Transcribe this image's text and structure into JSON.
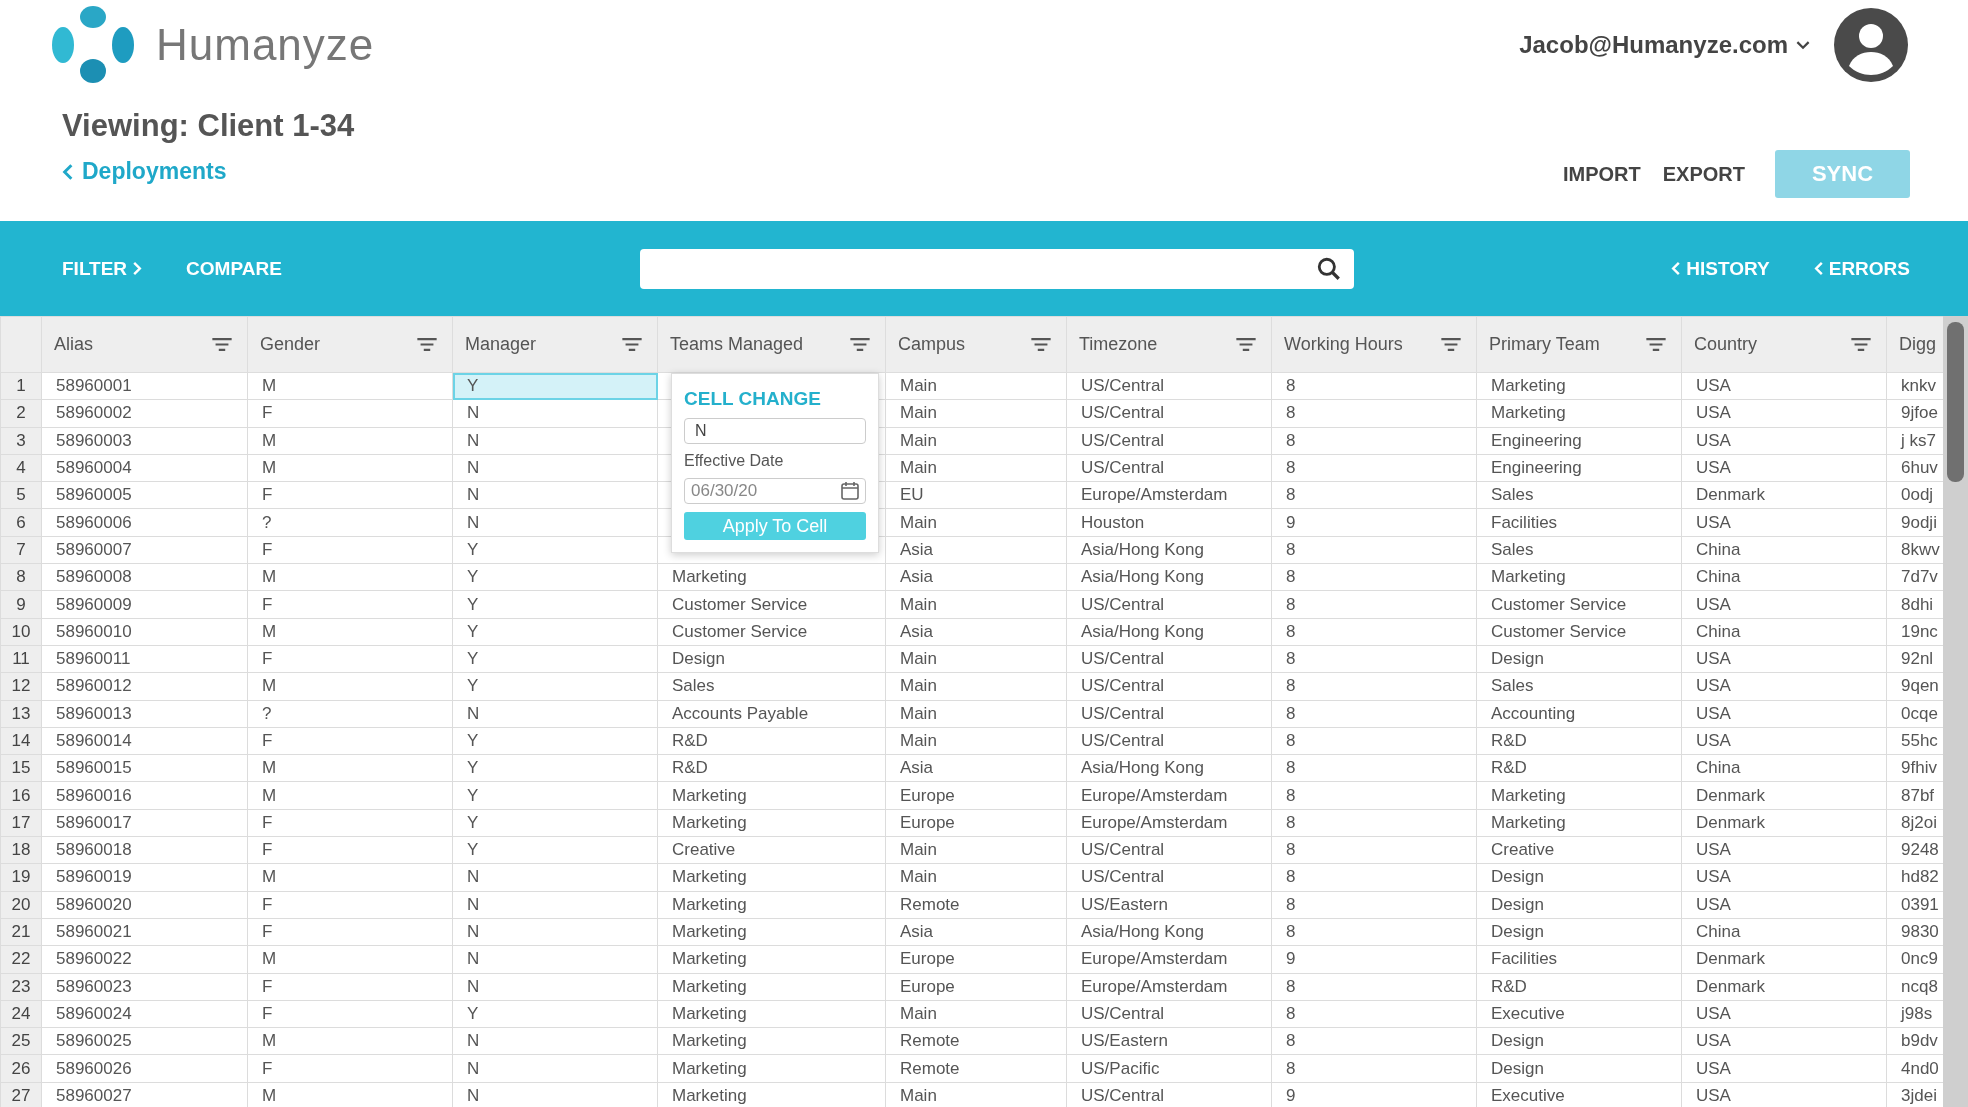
{
  "brand": {
    "name": "Humanyze"
  },
  "user": {
    "email": "Jacob@Humanyze.com"
  },
  "page": {
    "title": "Viewing: Client 1-34",
    "back_link": "Deployments"
  },
  "actions": [
    "IMPORT",
    "EXPORT"
  ],
  "sync_button": {
    "label": "SYNC",
    "disabled": true
  },
  "toolbar": {
    "left": [
      "FILTER",
      "COMPARE"
    ],
    "right": [
      "HISTORY",
      "ERRORS"
    ]
  },
  "columns": [
    {
      "label": "Alias",
      "filterable": true
    },
    {
      "label": "Gender",
      "filterable": true
    },
    {
      "label": "Manager",
      "filterable": true
    },
    {
      "label": "Teams Managed",
      "filterable": true
    },
    {
      "label": "Campus",
      "filterable": true
    },
    {
      "label": "Timezone",
      "filterable": true
    },
    {
      "label": "Working Hours",
      "filterable": true
    },
    {
      "label": "Primary Team",
      "filterable": true
    },
    {
      "label": "Country",
      "filterable": true
    },
    {
      "label": "Digg",
      "filterable": false
    }
  ],
  "rows": [
    {
      "num": "1",
      "cells": [
        "58960001",
        "M",
        "Y",
        null,
        "Main",
        "US/Central",
        "8",
        "Marketing",
        "USA",
        "knkv"
      ],
      "manager_selected": true
    },
    {
      "num": "2",
      "cells": [
        "58960002",
        "F",
        "N",
        null,
        "Main",
        "US/Central",
        "8",
        "Marketing",
        "USA",
        "9jfoe"
      ],
      "manager_selected": false
    },
    {
      "num": "3",
      "cells": [
        "58960003",
        "M",
        "N",
        null,
        "Main",
        "US/Central",
        "8",
        "Engineering",
        "USA",
        "j ks7"
      ],
      "manager_selected": false
    },
    {
      "num": "4",
      "cells": [
        "58960004",
        "M",
        "N",
        null,
        "Main",
        "US/Central",
        "8",
        "Engineering",
        "USA",
        "6huv"
      ],
      "manager_selected": false
    },
    {
      "num": "5",
      "cells": [
        "58960005",
        "F",
        "N",
        null,
        "EU",
        "Europe/Amsterdam",
        "8",
        "Sales",
        "Denmark",
        "0odj"
      ],
      "manager_selected": false
    },
    {
      "num": "6",
      "cells": [
        "58960006",
        "?",
        "N",
        null,
        "Main",
        "Houston",
        "9",
        "Facilities",
        "USA",
        "9odji"
      ],
      "manager_selected": false
    },
    {
      "num": "7",
      "cells": [
        "58960007",
        "F",
        "Y",
        null,
        "Asia",
        "Asia/Hong Kong",
        "8",
        "Sales",
        "China",
        "8kwv"
      ],
      "manager_selected": false
    },
    {
      "num": "8",
      "cells": [
        "58960008",
        "M",
        "Y",
        "Marketing",
        "Asia",
        "Asia/Hong Kong",
        "8",
        "Marketing",
        "China",
        "7d7v"
      ],
      "manager_selected": false
    },
    {
      "num": "9",
      "cells": [
        "58960009",
        "F",
        "Y",
        "Customer Service",
        "Main",
        "US/Central",
        "8",
        "Customer Service",
        "USA",
        "8dhi"
      ],
      "manager_selected": false
    },
    {
      "num": "10",
      "cells": [
        "58960010",
        "M",
        "Y",
        "Customer Service",
        "Asia",
        "Asia/Hong Kong",
        "8",
        "Customer Service",
        "China",
        "19nc"
      ],
      "manager_selected": false
    },
    {
      "num": "11",
      "cells": [
        "58960011",
        "F",
        "Y",
        "Design",
        "Main",
        "US/Central",
        "8",
        "Design",
        "USA",
        "92nl"
      ],
      "manager_selected": false
    },
    {
      "num": "12",
      "cells": [
        "58960012",
        "M",
        "Y",
        "Sales",
        "Main",
        "US/Central",
        "8",
        "Sales",
        "USA",
        "9qen"
      ],
      "manager_selected": false
    },
    {
      "num": "13",
      "cells": [
        "58960013",
        "?",
        "N",
        "Accounts Payable",
        "Main",
        "US/Central",
        "8",
        "Accounting",
        "USA",
        "0cqe"
      ],
      "manager_selected": false
    },
    {
      "num": "14",
      "cells": [
        "58960014",
        "F",
        "Y",
        "R&D",
        "Main",
        "US/Central",
        "8",
        "R&D",
        "USA",
        "55hc"
      ],
      "manager_selected": false
    },
    {
      "num": "15",
      "cells": [
        "58960015",
        "M",
        "Y",
        "R&D",
        "Asia",
        "Asia/Hong Kong",
        "8",
        "R&D",
        "China",
        "9fhiv"
      ],
      "manager_selected": false
    },
    {
      "num": "16",
      "cells": [
        "58960016",
        "M",
        "Y",
        "Marketing",
        "Europe",
        "Europe/Amsterdam",
        "8",
        "Marketing",
        "Denmark",
        "87bf"
      ],
      "manager_selected": false
    },
    {
      "num": "17",
      "cells": [
        "58960017",
        "F",
        "Y",
        "Marketing",
        "Europe",
        "Europe/Amsterdam",
        "8",
        "Marketing",
        "Denmark",
        "8j2oi"
      ],
      "manager_selected": false
    },
    {
      "num": "18",
      "cells": [
        "58960018",
        "F",
        "Y",
        "Creative",
        "Main",
        "US/Central",
        "8",
        "Creative",
        "USA",
        "9248"
      ],
      "manager_selected": false
    },
    {
      "num": "19",
      "cells": [
        "58960019",
        "M",
        "N",
        "Marketing",
        "Main",
        "US/Central",
        "8",
        "Design",
        "USA",
        "hd82"
      ],
      "manager_selected": false
    },
    {
      "num": "20",
      "cells": [
        "58960020",
        "F",
        "N",
        "Marketing",
        "Remote",
        "US/Eastern",
        "8",
        "Design",
        "USA",
        "0391"
      ],
      "manager_selected": false
    },
    {
      "num": "21",
      "cells": [
        "58960021",
        "F",
        "N",
        "Marketing",
        "Asia",
        "Asia/Hong Kong",
        "8",
        "Design",
        "China",
        "9830"
      ],
      "manager_selected": false
    },
    {
      "num": "22",
      "cells": [
        "58960022",
        "M",
        "N",
        "Marketing",
        "Europe",
        "Europe/Amsterdam",
        "9",
        "Facilities",
        "Denmark",
        "0nc9"
      ],
      "manager_selected": false
    },
    {
      "num": "23",
      "cells": [
        "58960023",
        "F",
        "N",
        "Marketing",
        "Europe",
        "Europe/Amsterdam",
        "8",
        "R&D",
        "Denmark",
        "ncq8"
      ],
      "manager_selected": false
    },
    {
      "num": "24",
      "cells": [
        "58960024",
        "F",
        "Y",
        "Marketing",
        "Main",
        "US/Central",
        "8",
        "Executive",
        "USA",
        "j98s"
      ],
      "manager_selected": false
    },
    {
      "num": "25",
      "cells": [
        "58960025",
        "M",
        "N",
        "Marketing",
        "Remote",
        "US/Eastern",
        "8",
        "Design",
        "USA",
        "b9dv"
      ],
      "manager_selected": false
    },
    {
      "num": "26",
      "cells": [
        "58960026",
        "F",
        "N",
        "Marketing",
        "Remote",
        "US/Pacific",
        "8",
        "Design",
        "USA",
        "4nd0"
      ],
      "manager_selected": false
    },
    {
      "num": "27",
      "cells": [
        "58960027",
        "M",
        "N",
        "Marketing",
        "Main",
        "US/Central",
        "9",
        "Executive",
        "USA",
        "3jdei"
      ],
      "manager_selected": false
    }
  ],
  "cell_change": {
    "title": "CELL CHANGE",
    "value": "N",
    "date_label": "Effective Date",
    "date_value": "06/30/20",
    "apply_button": "Apply To Cell"
  }
}
